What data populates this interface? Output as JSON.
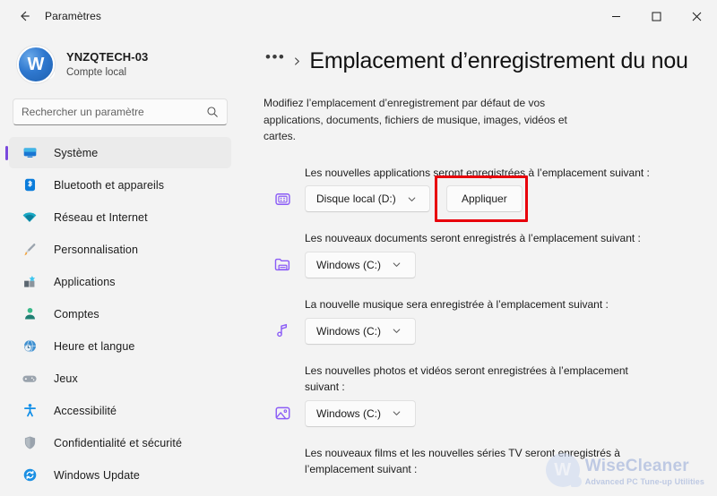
{
  "window": {
    "title": "Paramètres",
    "back_icon": "back-arrow-icon",
    "minimize_label": "—",
    "maximize_label": "□",
    "close_label": "✕"
  },
  "sidebar": {
    "account": {
      "avatar_letter": "W",
      "name": "YNZQTECH-03",
      "type": "Compte local"
    },
    "search": {
      "placeholder": "Rechercher un paramètre",
      "value": "",
      "icon": "search-icon"
    },
    "items": [
      {
        "label": "Système",
        "icon": "monitor-icon",
        "selected": true
      },
      {
        "label": "Bluetooth et appareils",
        "icon": "bluetooth-icon",
        "selected": false
      },
      {
        "label": "Réseau et Internet",
        "icon": "wifi-icon",
        "selected": false
      },
      {
        "label": "Personnalisation",
        "icon": "paintbrush-icon",
        "selected": false
      },
      {
        "label": "Applications",
        "icon": "apps-icon",
        "selected": false
      },
      {
        "label": "Comptes",
        "icon": "person-icon",
        "selected": false
      },
      {
        "label": "Heure et langue",
        "icon": "clock-globe-icon",
        "selected": false
      },
      {
        "label": "Jeux",
        "icon": "gamepad-icon",
        "selected": false
      },
      {
        "label": "Accessibilité",
        "icon": "accessibility-icon",
        "selected": false
      },
      {
        "label": "Confidentialité et sécurité",
        "icon": "shield-icon",
        "selected": false
      },
      {
        "label": "Windows Update",
        "icon": "update-icon",
        "selected": false
      }
    ],
    "accent_color": "#7a49dd"
  },
  "content": {
    "breadcrumb_ellipsis": "•••",
    "breadcrumb_chevron": "chevron-right-icon",
    "page_title": "Emplacement d’enregistrement du nou",
    "description": "Modifiez l’emplacement d’enregistrement par défaut de vos applications, documents, fichiers de musique, images, vidéos et cartes.",
    "sections": [
      {
        "label": "Les nouvelles applications seront enregistrées à l’emplacement suivant :",
        "icon": "apps-grid-icon",
        "value": "Disque local (D:)",
        "has_apply": true,
        "apply_label": "Appliquer",
        "highlighted": true
      },
      {
        "label": "Les nouveaux documents seront enregistrés à l’emplacement suivant :",
        "icon": "folder-icon",
        "value": "Windows (C:)",
        "has_apply": false
      },
      {
        "label": "La nouvelle musique sera enregistrée à l’emplacement suivant :",
        "icon": "music-note-icon",
        "value": "Windows (C:)",
        "has_apply": false
      },
      {
        "label": "Les nouvelles photos et vidéos seront enregistrées à l’emplacement suivant :",
        "icon": "image-icon",
        "value": "Windows (C:)",
        "has_apply": false
      },
      {
        "label": "Les nouveaux films et les nouvelles séries TV seront enregistrés à l’emplacement suivant :",
        "icon": "film-icon",
        "value": "",
        "has_apply": false
      }
    ],
    "highlight_color": "#e8000b",
    "dropdown_caret": "chevron-down-icon"
  },
  "watermark": {
    "letter": "W",
    "title": "WiseCleaner",
    "subtitle": "Advanced PC Tune-up Utilities"
  }
}
